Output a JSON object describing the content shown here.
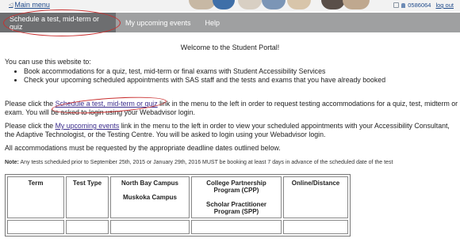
{
  "header": {
    "main_menu": "Main menu",
    "user_id": "0586064",
    "logout": "log out"
  },
  "nav": {
    "tabs": [
      {
        "label": "Schedule a test, mid-term or quiz"
      },
      {
        "label": "My upcoming events"
      },
      {
        "label": "Help"
      }
    ]
  },
  "content": {
    "welcome": "Welcome to the Student Portal!",
    "intro": "You can use this website to:",
    "bullets": [
      "Book accommodations for a quiz, test, mid-term or final exams with Student Accessibility Services",
      "Check your upcoming scheduled appointments with SAS staff and the tests and exams that you have already booked"
    ],
    "para1": {
      "before": "Please click the ",
      "link": "Schedule a test, mid-term or quiz",
      "after": " link in the menu to the left in order to request testing accommodations for a quiz, test, midterm or exam. You will be asked to login using your Webadvisor login."
    },
    "para2": {
      "before": "Please click the ",
      "link": "My upcoming events",
      "after": " link in the menu to the left in order to view your scheduled appointments with your Accessibility Consultant, the Adaptive Technologist, or the Testing Centre. You will be asked to login using your Webadvisor login."
    },
    "para3": "All accommodations must be requested by the appropriate deadline dates outlined below.",
    "note_label": "Note:",
    "note": " Any tests scheduled prior to September 25th, 2015 or January 29th, 2016 MUST be booking at least 7 days in advance of the scheduled date of the test"
  },
  "table": {
    "headers": {
      "term": "Term",
      "test_type": "Test Type",
      "north_bay": "North Bay Campus",
      "muskoka": "Muskoka Campus",
      "cpp": "College Partnership Program (CPP)",
      "spp": "Scholar Practitioner Program (SPP)",
      "online": "Online/Distance"
    }
  },
  "colors": {
    "nav_bg": "#9fa0a1",
    "active_tab": "#6d6e70",
    "annotation_red": "#c92f2f",
    "link": "#3b2c8c"
  }
}
